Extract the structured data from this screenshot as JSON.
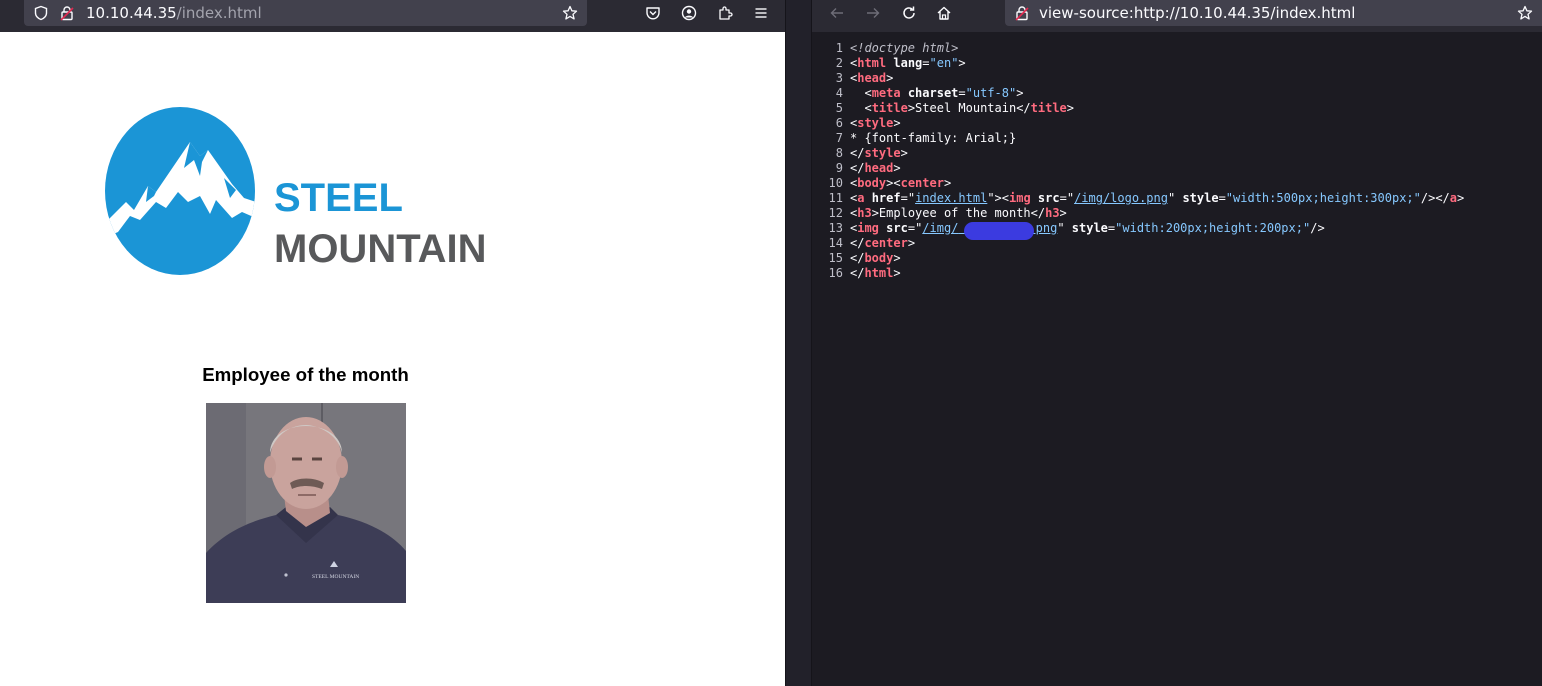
{
  "left_browser": {
    "url_host": "10.10.44.35",
    "url_path": "/index.html",
    "icons": [
      "shield-icon",
      "lock-icon",
      "star-icon",
      "pocket-icon",
      "account-icon",
      "extensions-icon",
      "menu-icon"
    ]
  },
  "page": {
    "logo_text_line1": "STEEL",
    "logo_text_line2": "MOUNTAIN",
    "heading": "Employee of the month",
    "photo_badge": "STEEL MOUNTAIN"
  },
  "right_browser": {
    "url": "view-source:http://10.10.44.35/index.html",
    "icons": [
      "back-icon",
      "forward-icon",
      "reload-icon",
      "home-icon",
      "lock-icon",
      "star-icon"
    ]
  },
  "source_lines": {
    "l1": {
      "n": "1",
      "doctype": "<!doctype html>"
    },
    "l2": {
      "n": "2",
      "open": "<",
      "tag": "html",
      "attr": "lang",
      "val": "\"en\"",
      "close": ">"
    },
    "l3": {
      "n": "3",
      "open": "<",
      "tag": "head",
      "close": ">"
    },
    "l4": {
      "n": "4",
      "open": "  <",
      "tag": "meta",
      "attr": "charset",
      "val": "\"utf-8\"",
      "close": ">"
    },
    "l5": {
      "n": "5",
      "open": "  <",
      "tag": "title",
      "text": "Steel Mountain",
      "end_open": "</",
      "end_tag": "title",
      "close": ">"
    },
    "l6": {
      "n": "6",
      "open": "<",
      "tag": "style",
      "close": ">"
    },
    "l7": {
      "n": "7",
      "text": "* {font-family: Arial;}"
    },
    "l8": {
      "n": "8",
      "open": "</",
      "tag": "style",
      "close": ">"
    },
    "l9": {
      "n": "9",
      "open": "</",
      "tag": "head",
      "close": ">"
    },
    "l10": {
      "n": "10",
      "open": "<",
      "tag": "body",
      "mid": "><",
      "tag2": "center",
      "close": ">"
    },
    "l11": {
      "n": "11",
      "open": "<",
      "tag": "a",
      "attr": "href",
      "val_link": "index.html",
      "mid": "\"><",
      "tag2": "img",
      "attr2": "src",
      "val_link2": "/img/logo.png",
      "attr3": "style",
      "val3": "\"width:500px;height:300px;\"",
      "end": "/></",
      "end_tag": "a",
      "close": ">"
    },
    "l12": {
      "n": "12",
      "open": "<",
      "tag": "h3",
      "text": "Employee of the month",
      "end_open": "</",
      "end_tag": "h3",
      "close": ">"
    },
    "l13": {
      "n": "13",
      "open": "<",
      "tag": "img",
      "attr": "src",
      "val_link_start": "/img/",
      "val_link_end": ".png",
      "attr2": "style",
      "val2": "\"width:200px;height:200px;\"",
      "close": "/>"
    },
    "l14": {
      "n": "14",
      "open": "</",
      "tag": "center",
      "close": ">"
    },
    "l15": {
      "n": "15",
      "open": "</",
      "tag": "body",
      "close": ">"
    },
    "l16": {
      "n": "16",
      "open": "</",
      "tag": "html",
      "close": ">"
    }
  },
  "colors": {
    "logo_blue": "#1b95d6",
    "logo_gray": "#58595b",
    "redaction": "#3b3be0"
  }
}
